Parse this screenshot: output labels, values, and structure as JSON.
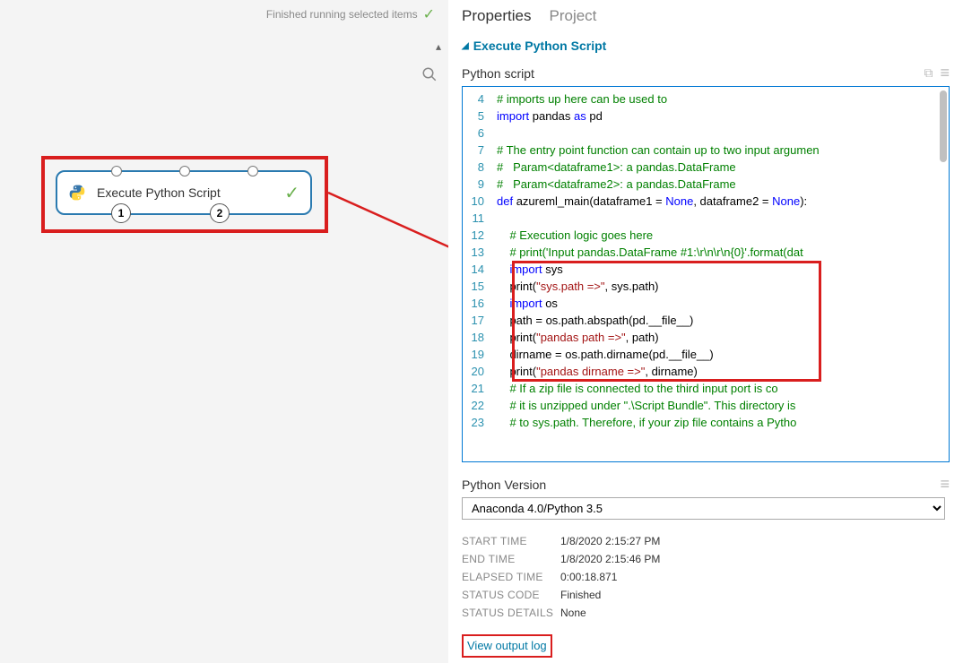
{
  "status": {
    "text": "Finished running selected items"
  },
  "node": {
    "label": "Execute Python Script",
    "port1": "1",
    "port2": "2"
  },
  "tabs": {
    "properties": "Properties",
    "project": "Project"
  },
  "section": {
    "title": "Execute Python Script"
  },
  "scriptLabel": "Python script",
  "code": {
    "startLine": 4,
    "lines": [
      {
        "n": 4,
        "segs": [
          {
            "t": "# imports up here can be used to",
            "c": "c-comment"
          }
        ]
      },
      {
        "n": 5,
        "segs": [
          {
            "t": "import",
            "c": "c-keyword"
          },
          {
            "t": " pandas "
          },
          {
            "t": "as",
            "c": "c-keyword"
          },
          {
            "t": " pd"
          }
        ]
      },
      {
        "n": 6,
        "segs": []
      },
      {
        "n": 7,
        "segs": [
          {
            "t": "# The entry point function can contain up to two input argumen",
            "c": "c-comment"
          }
        ]
      },
      {
        "n": 8,
        "segs": [
          {
            "t": "#   Param<dataframe1>: a pandas.DataFrame",
            "c": "c-comment"
          }
        ]
      },
      {
        "n": 9,
        "segs": [
          {
            "t": "#   Param<dataframe2>: a pandas.DataFrame",
            "c": "c-comment"
          }
        ]
      },
      {
        "n": 10,
        "segs": [
          {
            "t": "def",
            "c": "c-def"
          },
          {
            "t": " azureml_main(dataframe1 = "
          },
          {
            "t": "None",
            "c": "c-none"
          },
          {
            "t": ", dataframe2 = "
          },
          {
            "t": "None",
            "c": "c-none"
          },
          {
            "t": "):"
          }
        ]
      },
      {
        "n": 11,
        "segs": []
      },
      {
        "n": 12,
        "segs": [
          {
            "t": "    "
          },
          {
            "t": "# Execution logic goes here",
            "c": "c-comment"
          }
        ]
      },
      {
        "n": 13,
        "segs": [
          {
            "t": "    "
          },
          {
            "t": "# print('Input pandas.DataFrame #1:\\r\\n\\r\\n{0}'.format(dat",
            "c": "c-comment"
          }
        ]
      },
      {
        "n": 14,
        "segs": [
          {
            "t": "    "
          },
          {
            "t": "import",
            "c": "c-keyword"
          },
          {
            "t": " sys"
          }
        ]
      },
      {
        "n": 15,
        "segs": [
          {
            "t": "    print("
          },
          {
            "t": "\"sys.path =>\"",
            "c": "c-string"
          },
          {
            "t": ", sys.path)"
          }
        ]
      },
      {
        "n": 16,
        "segs": [
          {
            "t": "    "
          },
          {
            "t": "import",
            "c": "c-keyword"
          },
          {
            "t": " os"
          }
        ]
      },
      {
        "n": 17,
        "segs": [
          {
            "t": "    path = os.path.abspath(pd.__file__)"
          }
        ]
      },
      {
        "n": 18,
        "segs": [
          {
            "t": "    print("
          },
          {
            "t": "\"pandas path =>\"",
            "c": "c-string"
          },
          {
            "t": ", path)"
          }
        ]
      },
      {
        "n": 19,
        "segs": [
          {
            "t": "    dirname = os.path.dirname(pd.__file__)"
          }
        ]
      },
      {
        "n": 20,
        "segs": [
          {
            "t": "    print("
          },
          {
            "t": "\"pandas dirname =>\"",
            "c": "c-string"
          },
          {
            "t": ", dirname)"
          }
        ]
      },
      {
        "n": 21,
        "segs": [
          {
            "t": "    "
          },
          {
            "t": "# If a zip file is connected to the third input port is co",
            "c": "c-comment"
          }
        ]
      },
      {
        "n": 22,
        "segs": [
          {
            "t": "    "
          },
          {
            "t": "# it is unzipped under \".\\Script Bundle\". This directory is",
            "c": "c-comment"
          }
        ]
      },
      {
        "n": 23,
        "segs": [
          {
            "t": "    "
          },
          {
            "t": "# to sys.path. Therefore, if your zip file contains a Pytho",
            "c": "c-comment"
          }
        ]
      }
    ]
  },
  "versionLabel": "Python Version",
  "versionValue": "Anaconda 4.0/Python 3.5",
  "info": [
    {
      "k": "START TIME",
      "v": "1/8/2020 2:15:27 PM"
    },
    {
      "k": "END TIME",
      "v": "1/8/2020 2:15:46 PM"
    },
    {
      "k": "ELAPSED TIME",
      "v": "0:00:18.871"
    },
    {
      "k": "STATUS CODE",
      "v": "Finished"
    },
    {
      "k": "STATUS DETAILS",
      "v": "None"
    }
  ],
  "outputLink": "View output log"
}
